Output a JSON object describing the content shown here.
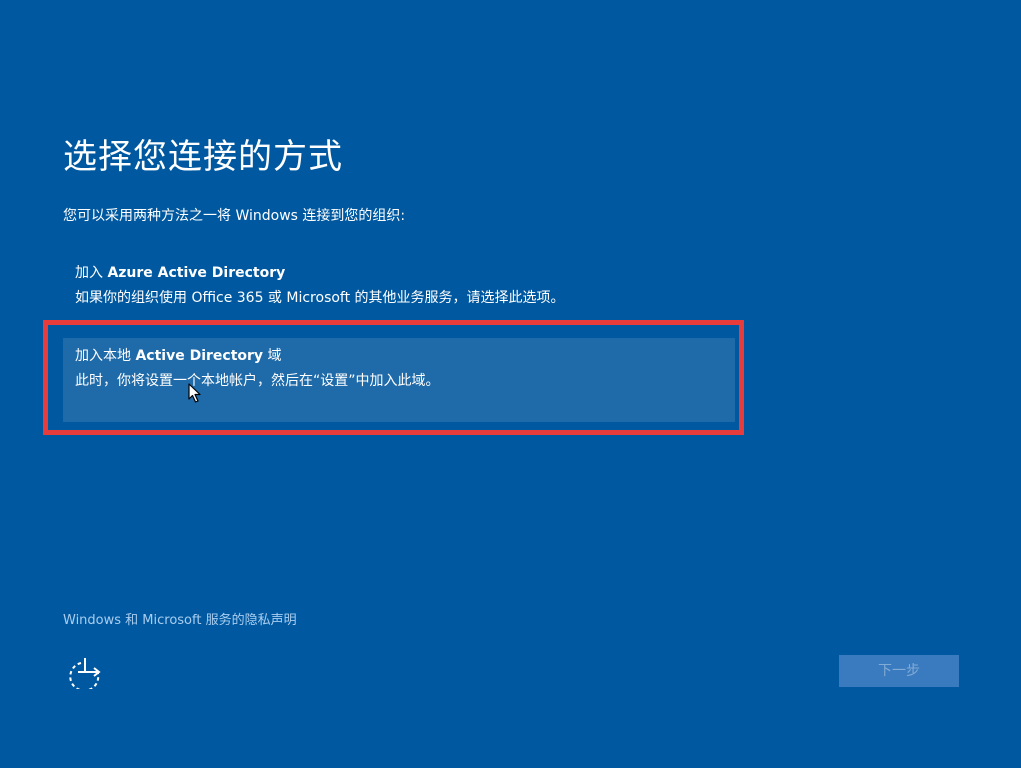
{
  "header": {
    "title": "选择您连接的方式",
    "subtitle": "您可以采用两种方法之一将 Windows 连接到您的组织:"
  },
  "options": [
    {
      "title_prefix": "加入 ",
      "title_bold": "Azure Active Directory",
      "title_suffix": "",
      "description": "如果你的组织使用 Office 365 或 Microsoft 的其他业务服务，请选择此选项。",
      "selected": false
    },
    {
      "title_prefix": "加入本地 ",
      "title_bold": "Active Directory",
      "title_suffix": " 域",
      "description": "此时，你将设置一个本地帐户，然后在“设置”中加入此域。",
      "selected": true
    }
  ],
  "footer": {
    "privacy_link": "Windows 和 Microsoft 服务的隐私声明",
    "next_button": "下一步",
    "next_enabled": false,
    "accessibility_icon": "ease-of-access-icon"
  },
  "colors": {
    "background": "#0059a0",
    "selected_option": "#1f6aa9",
    "highlight_border": "#e83c3c",
    "link": "#a9cdf0",
    "button_disabled_bg": "#3a7bbf",
    "button_disabled_text": "#82aad6"
  }
}
